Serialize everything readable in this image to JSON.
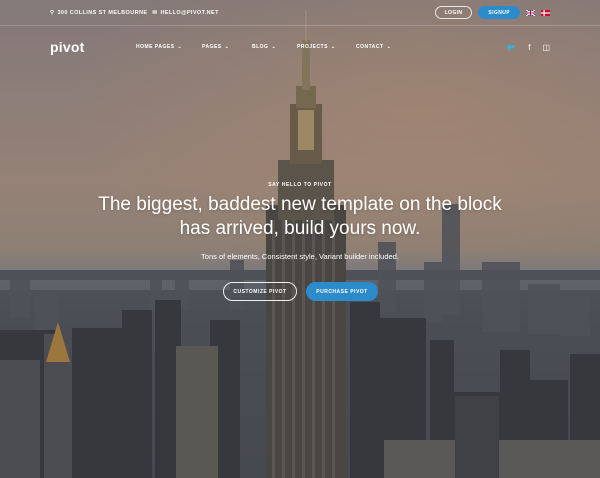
{
  "topbar": {
    "address": "300 COLLINS ST MELBOURNE",
    "email": "HELLO@PIVOT.NET",
    "login_label": "LOGIN",
    "signup_label": "SIGNUP",
    "flags": [
      "uk-flag",
      "denmark-flag"
    ]
  },
  "nav": {
    "logo": "pivot",
    "menu": [
      {
        "label": "HOME PAGES"
      },
      {
        "label": "PAGES"
      },
      {
        "label": "BLOG"
      },
      {
        "label": "PROJECTS"
      },
      {
        "label": "CONTACT"
      }
    ],
    "social": [
      {
        "icon": "twitter-icon",
        "glyph": "🐦"
      },
      {
        "icon": "facebook-icon",
        "glyph": "f"
      },
      {
        "icon": "instagram-icon",
        "glyph": "◫"
      }
    ]
  },
  "hero": {
    "eyebrow": "SAY HELLO TO PIVOT",
    "headline_line1": "The biggest, baddest new template on the block",
    "headline_line2": "has arrived, build yours now.",
    "subtext": "Tons of elements, Consistent style, Variant builder included.",
    "customize_label": "CUSTOMIZE PIVOT",
    "purchase_label": "PURCHASE PIVOT"
  },
  "colors": {
    "accent": "#2c8ccb"
  }
}
